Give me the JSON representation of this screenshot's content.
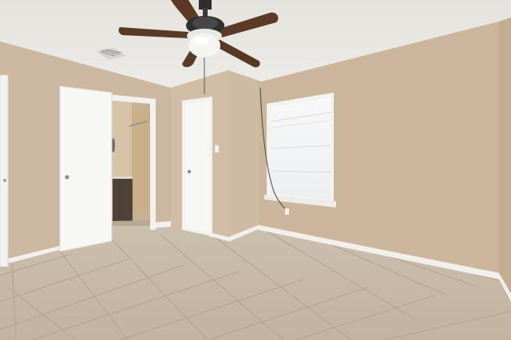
{
  "scene": {
    "kind": "photo-empty-room",
    "colors": {
      "ceiling": "#e9e6e0",
      "wall_left": "#cdb9a2",
      "wall_back": "#d3bfa8",
      "wall_right": "#cbb59d",
      "floor": "#c9bba9",
      "trim": "#f4f2ee",
      "door": "#f6f6f4",
      "fan_blade": "#5a3a26",
      "fan_metal": "#2f2f2f"
    }
  }
}
